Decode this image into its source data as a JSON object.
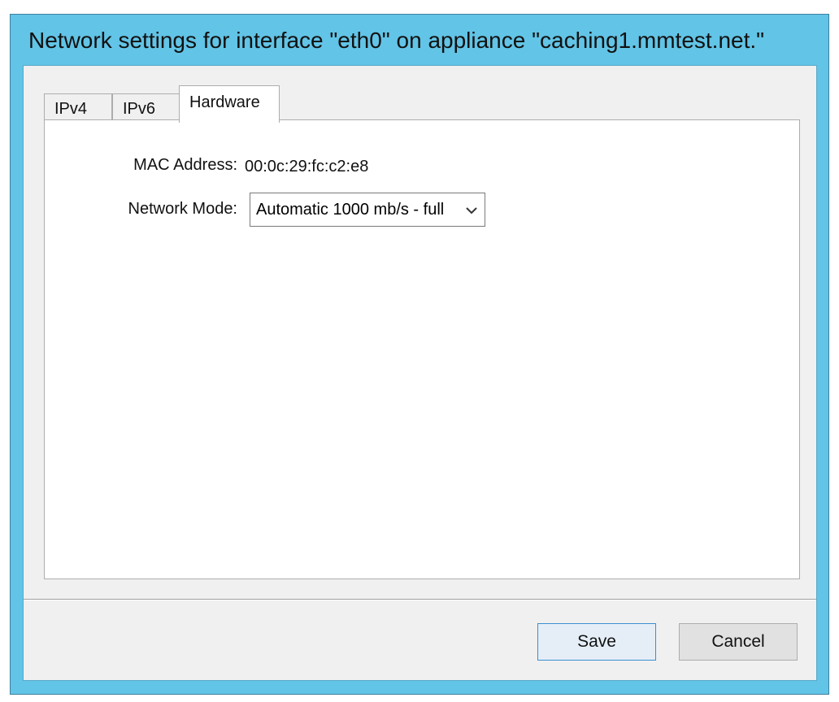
{
  "window": {
    "title": "Network settings for interface \"eth0\" on appliance \"caching1.mmtest.net.\""
  },
  "tabs": [
    {
      "label": "IPv4",
      "selected": false
    },
    {
      "label": "IPv6",
      "selected": false
    },
    {
      "label": "Hardware",
      "selected": true
    }
  ],
  "hardware": {
    "mac_label": "MAC Address:",
    "mac_value": "00:0c:29:fc:c2:e8",
    "mode_label": "Network Mode:",
    "mode_value": "Automatic 1000 mb/s - full"
  },
  "buttons": {
    "save": "Save",
    "cancel": "Cancel"
  },
  "colors": {
    "window_frame": "#62c4e6",
    "client_bg": "#f0f0f0",
    "save_border": "#3c8fce"
  }
}
